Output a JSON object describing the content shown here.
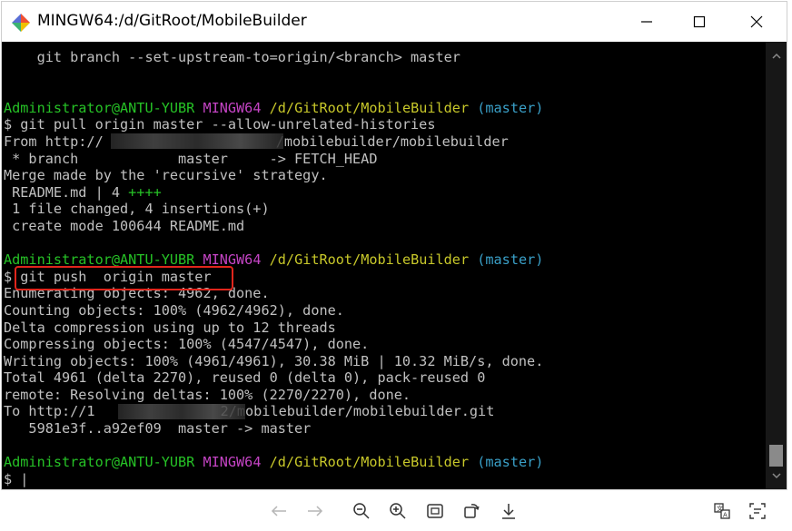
{
  "window": {
    "title": "MINGW64:/d/GitRoot/MobileBuilder",
    "icon": "git-bash-icon"
  },
  "controls": {
    "minimize": "minimize-icon",
    "maximize": "maximize-icon",
    "close": "close-icon"
  },
  "terminal": {
    "line1": "    git branch --set-upstream-to=origin/<branch> master",
    "prompt1": {
      "user": "Administrator@ANTU-YUBR",
      "shell": "MINGW64",
      "path": "/d/GitRoot/MobileBuilder",
      "branch": "(master)"
    },
    "cmd1": "$ git pull origin master --allow-unrelated-histories",
    "from_prefix": "From http://",
    "from_suffix": "/mobilebuilder/mobilebuilder",
    "branch_line": " * branch            master     -> FETCH_HEAD",
    "merge_line": "Merge made by the 'recursive' strategy.",
    "readme_stat": " README.md | 4 ",
    "readme_plus": "++++",
    "files_changed": " 1 file changed, 4 insertions(+)",
    "create_mode": " create mode 100644 README.md",
    "prompt2": {
      "user": "Administrator@ANTU-YUBR",
      "shell": "MINGW64",
      "path": "/d/GitRoot/MobileBuilder",
      "branch": "(master)"
    },
    "cmd2": "$ git push  origin master",
    "enumerating": "Enumerating objects: 4962, done.",
    "counting": "Counting objects: 100% (4962/4962), done.",
    "delta": "Delta compression using up to 12 threads",
    "compressing": "Compressing objects: 100% (4547/4547), done.",
    "writing": "Writing objects: 100% (4961/4961), 30.38 MiB | 10.32 MiB/s, done.",
    "total": "Total 4961 (delta 2270), reused 0 (delta 0), pack-reused 0",
    "remote": "remote: Resolving deltas: 100% (2270/2270), done.",
    "to_prefix": "To http://1",
    "to_suffix": "2/mobilebuilder/mobilebuilder.git",
    "ref_update": "   5981e3f..a92ef09  master -> master",
    "prompt3": {
      "user": "Administrator@ANTU-YUBR",
      "shell": "MINGW64",
      "path": "/d/GitRoot/MobileBuilder",
      "branch": "(master)"
    },
    "cursor_prompt": "$ |"
  },
  "colors": {
    "user": "#26c226",
    "shell": "#c544c5",
    "path": "#c8c82a",
    "branch": "#3aa0c8",
    "highlight": "#e0251c"
  },
  "toolbar": {
    "items": [
      "back-arrow-icon",
      "forward-arrow-icon",
      "zoom-out-icon",
      "zoom-in-icon",
      "fit-screen-icon",
      "rotate-icon",
      "download-icon",
      "translate-icon",
      "text-recognition-icon"
    ]
  }
}
